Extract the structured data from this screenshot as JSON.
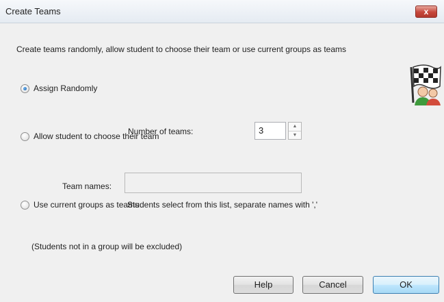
{
  "window": {
    "title": "Create Teams",
    "close_label": "x"
  },
  "description": "Create teams randomly, allow student to choose their team or use current groups as teams",
  "options": {
    "random": {
      "label": "Assign Randomly",
      "checked": true
    },
    "choose": {
      "label": "Allow student to choose their team",
      "checked": false
    },
    "groups": {
      "label": "Use current groups as teams",
      "checked": false
    }
  },
  "number_of_teams": {
    "label": "Number of teams:",
    "value": "3"
  },
  "team_names": {
    "label": "Team names:",
    "value": "",
    "hint": "Students select from this list, separate names with ','"
  },
  "groups_note": "(Students not in a group will be excluded)",
  "buttons": {
    "help": "Help",
    "cancel": "Cancel",
    "ok": "OK"
  },
  "icons": {
    "logo": "checkered-flag-students-icon",
    "spin_up": "arrow-up-icon",
    "spin_down": "arrow-down-icon"
  }
}
